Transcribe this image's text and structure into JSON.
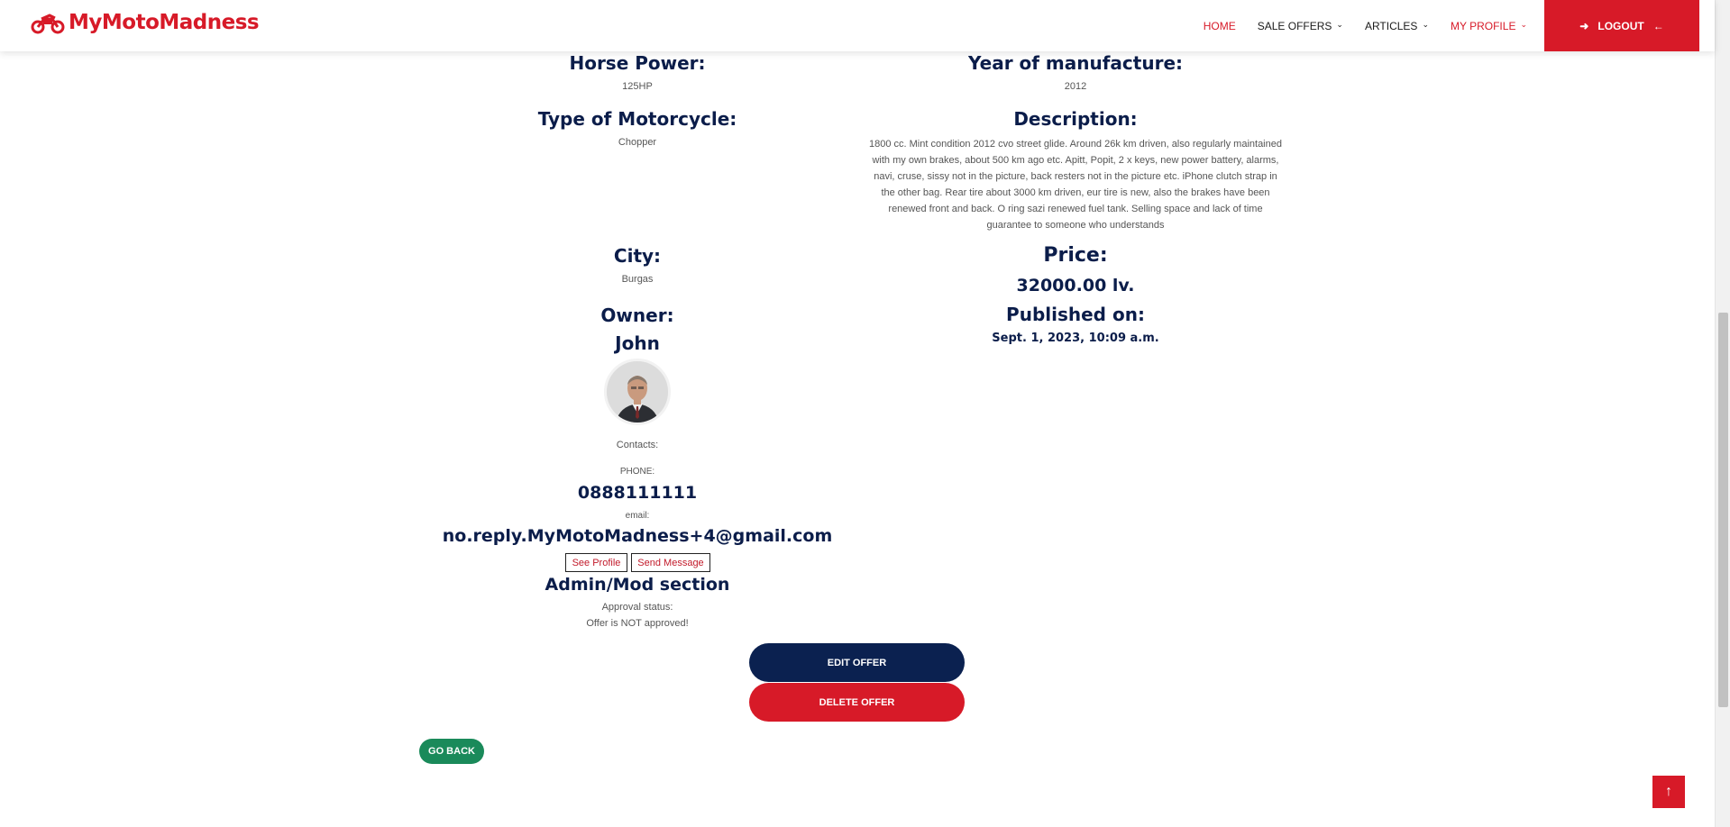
{
  "header": {
    "brand": "MyMotoMadness",
    "logo_icon": "motorcycle-icon",
    "nav": [
      {
        "label": "HOME",
        "active": true,
        "dropdown": false
      },
      {
        "label": "SALE OFFERS",
        "active": false,
        "dropdown": true
      },
      {
        "label": "ARTICLES",
        "active": false,
        "dropdown": true
      },
      {
        "label": "MY PROFILE",
        "active": true,
        "dropdown": true
      }
    ],
    "logout_label": "LOGOUT",
    "colors": {
      "brand": "#d71a28",
      "text": "#0b1d4a"
    }
  },
  "offer": {
    "horse_power_label": "Horse Power:",
    "horse_power": "125HP",
    "year_label": "Year of manufacture:",
    "year": "2012",
    "type_label": "Type of Motorcycle:",
    "type": "Chopper",
    "description_label": "Description:",
    "description": "1800 cc. Mint condition 2012 cvo street glide. Around 26k km driven, also regularly maintained with my own brakes, about 500 km ago etc. Apitt, Popit, 2 x keys, new power battery, alarms, navi, cruse, sissy not in the picture, back resters not in the picture etc. iPhone clutch strap in the other bag. Rear tire about 3000 km driven, eur tire is new, also the brakes have been renewed front and back. O ring sazi renewed fuel tank. Selling space and lack of time guarantee to someone who understands",
    "city_label": "City:",
    "city": "Burgas",
    "price_label": "Price:",
    "price": "32000.00 lv.",
    "owner_label": "Owner:",
    "owner": "John",
    "published_label": "Published on:",
    "published": "Sept. 1, 2023, 10:09 a.m.",
    "contacts_label": "Contacts:",
    "phone_label": "PHONE:",
    "phone": "0888111111",
    "email_label": "email:",
    "email": "no.reply.MyMotoMadness+4@gmail.com"
  },
  "actions": {
    "see_profile": "See Profile",
    "send_message": "Send Message",
    "edit_offer": "EDIT OFFER",
    "delete_offer": "DELETE OFFER",
    "go_back": "GO BACK"
  },
  "admin": {
    "title": "Admin/Mod section",
    "approval_label": "Approval status:",
    "approval_status": "Offer is NOT approved!"
  },
  "colors": {
    "edit_button": "#0b2150",
    "delete_button": "#d71a28",
    "go_back_button": "#1a8a5a",
    "to_top_button": "#d71a28"
  }
}
